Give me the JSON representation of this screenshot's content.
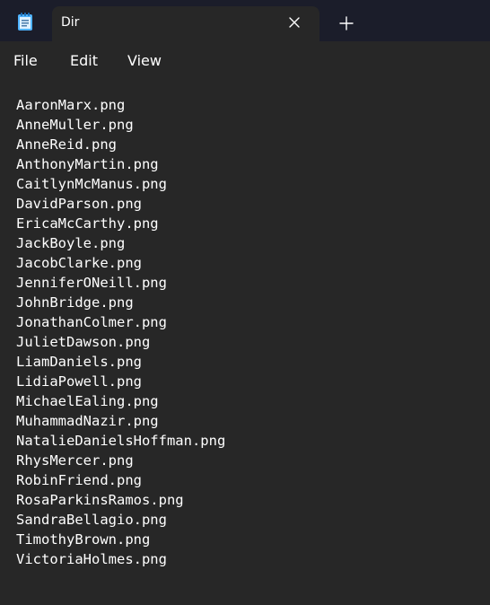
{
  "window": {
    "tab_title": "Dir",
    "app_icon": "notepad-icon",
    "close_icon": "close-icon",
    "new_tab_icon": "plus-icon"
  },
  "menu": {
    "file": "File",
    "edit": "Edit",
    "view": "View"
  },
  "document": {
    "lines": [
      "AaronMarx.png",
      "AnneMuller.png",
      "AnneReid.png",
      "AnthonyMartin.png",
      "CaitlynMcManus.png",
      "DavidParson.png",
      "EricaMcCarthy.png",
      "JackBoyle.png",
      "JacobClarke.png",
      "JenniferONeill.png",
      "JohnBridge.png",
      "JonathanColmer.png",
      "JulietDawson.png",
      "LiamDaniels.png",
      "LidiaPowell.png",
      "MichaelEaling.png",
      "MuhammadNazir.png",
      "NatalieDanielsHoffman.png",
      "RhysMercer.png",
      "RobinFriend.png",
      "RosaParkinsRamos.png",
      "SandraBellagio.png",
      "TimothyBrown.png",
      "VictoriaHolmes.png"
    ]
  },
  "colors": {
    "titlebar": "#1b1d2a",
    "background": "#272727",
    "text": "#ffffff",
    "icon_accent": "#4fb3ff"
  }
}
